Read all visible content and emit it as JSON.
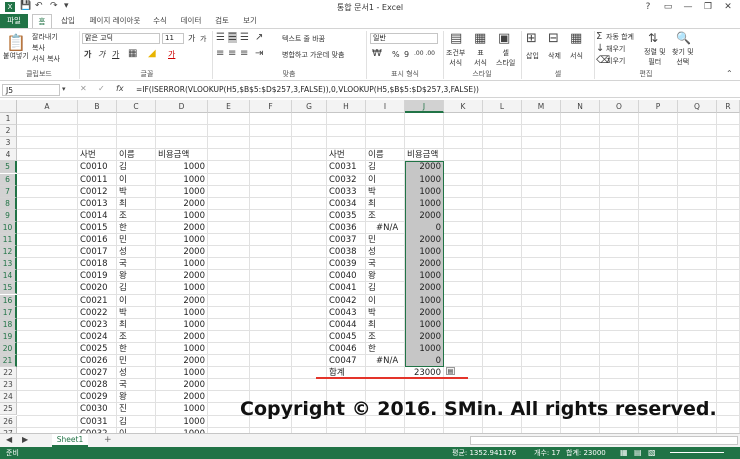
{
  "window": {
    "title": "통합 문서1 - Excel",
    "controls": [
      "?",
      "▭",
      "—",
      "❐",
      "✕"
    ]
  },
  "ribbon_tabs": [
    "파일",
    "홈",
    "삽입",
    "페이지 레이아웃",
    "수식",
    "데이터",
    "검토",
    "보기"
  ],
  "ribbon": {
    "clipboard": {
      "paste": "붙여넣기",
      "cut": "잘라내기",
      "copy": "복사",
      "format_painter": "서식 복사",
      "group": "클립보드"
    },
    "font": {
      "name": "맑은 고딕",
      "size": "11",
      "grow": "가",
      "shrink": "가",
      "bold": "가",
      "italic": "가",
      "underline": "가",
      "color_glyph": "가",
      "group": "글꼴"
    },
    "alignment": {
      "wrap": "텍스트 줄 바꿈",
      "merge": "병합하고 가운데 맞춤",
      "group": "맞춤"
    },
    "number": {
      "format": "일반",
      "percent": "%",
      "comma": "9",
      "inc_dec": ".00 .00",
      "group": "표시 형식"
    },
    "styles": {
      "conditional": "조건부\n서식",
      "table": "표\n서식",
      "cell": "셀\n스타일",
      "group": "스타일"
    },
    "cells": {
      "insert": "삽입",
      "delete": "삭제",
      "format": "서식",
      "group": "셀"
    },
    "editing": {
      "autosum": "자동 합계",
      "fill": "채우기",
      "clear": "지우기",
      "sort": "정렬 및\n필터",
      "find": "찾기 및\n선택",
      "group": "편집"
    }
  },
  "formula_bar": {
    "name_box": "J5",
    "formula": "=IF(ISERROR(VLOOKUP(H5,$B$5:$D$257,3,FALSE)),0,VLOOKUP(H5,$B$5:$D$257,3,FALSE))"
  },
  "columns": [
    "A",
    "B",
    "C",
    "D",
    "E",
    "F",
    "G",
    "H",
    "I",
    "J",
    "K",
    "L",
    "M",
    "N",
    "O",
    "P",
    "Q",
    "R"
  ],
  "row_numbers": [
    "1",
    "2",
    "3",
    "4",
    "5",
    "6",
    "7",
    "8",
    "9",
    "10",
    "11",
    "12",
    "13",
    "14",
    "15",
    "16",
    "17",
    "18",
    "19",
    "20",
    "21",
    "22",
    "23",
    "24",
    "25",
    "26",
    "27"
  ],
  "left_table": {
    "headers": [
      "사번",
      "이름",
      "비용금액"
    ],
    "rows": [
      [
        "C0010",
        "김",
        "1000"
      ],
      [
        "C0011",
        "이",
        "1000"
      ],
      [
        "C0012",
        "박",
        "1000"
      ],
      [
        "C0013",
        "최",
        "2000"
      ],
      [
        "C0014",
        "조",
        "1000"
      ],
      [
        "C0015",
        "한",
        "2000"
      ],
      [
        "C0016",
        "민",
        "1000"
      ],
      [
        "C0017",
        "성",
        "2000"
      ],
      [
        "C0018",
        "국",
        "1000"
      ],
      [
        "C0019",
        "왕",
        "2000"
      ],
      [
        "C0020",
        "김",
        "1000"
      ],
      [
        "C0021",
        "이",
        "2000"
      ],
      [
        "C0022",
        "박",
        "1000"
      ],
      [
        "C0023",
        "최",
        "1000"
      ],
      [
        "C0024",
        "조",
        "2000"
      ],
      [
        "C0025",
        "한",
        "1000"
      ],
      [
        "C0026",
        "민",
        "2000"
      ],
      [
        "C0027",
        "성",
        "1000"
      ],
      [
        "C0028",
        "국",
        "2000"
      ],
      [
        "C0029",
        "왕",
        "2000"
      ],
      [
        "C0030",
        "진",
        "1000"
      ],
      [
        "C0031",
        "김",
        "1000"
      ],
      [
        "C0032",
        "이",
        "1000"
      ]
    ]
  },
  "right_table": {
    "headers": [
      "사번",
      "이름",
      "비용금액"
    ],
    "rows": [
      [
        "C0031",
        "김",
        "2000"
      ],
      [
        "C0032",
        "이",
        "1000"
      ],
      [
        "C0033",
        "박",
        "1000"
      ],
      [
        "C0034",
        "최",
        "1000"
      ],
      [
        "C0035",
        "조",
        "2000"
      ],
      [
        "C0036",
        "#N/A",
        "0"
      ],
      [
        "C0037",
        "민",
        "2000"
      ],
      [
        "C0038",
        "성",
        "1000"
      ],
      [
        "C0039",
        "국",
        "2000"
      ],
      [
        "C0040",
        "왕",
        "1000"
      ],
      [
        "C0041",
        "김",
        "2000"
      ],
      [
        "C0042",
        "이",
        "1000"
      ],
      [
        "C0043",
        "박",
        "2000"
      ],
      [
        "C0044",
        "최",
        "1000"
      ],
      [
        "C0045",
        "조",
        "2000"
      ],
      [
        "C0046",
        "한",
        "1000"
      ],
      [
        "C0047",
        "#N/A",
        "0"
      ]
    ],
    "total_label": "합계",
    "total_value": "23000"
  },
  "watermark": "Copyright © 2016. SMin. All rights reserved.",
  "sheet_tabs": {
    "active": "Sheet1",
    "add": "+"
  },
  "status_bar": {
    "mode": "준비",
    "average": "평균: 1352.941176",
    "count": "개수: 17",
    "sum": "합계: 23000"
  },
  "colors": {
    "excel_green": "#217346",
    "selection_fill": "#c6c6c6",
    "underline_red": "#e4342a"
  }
}
